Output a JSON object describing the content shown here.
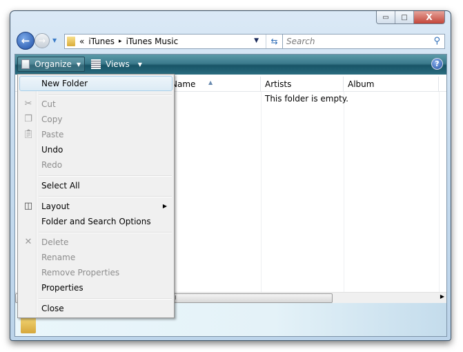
{
  "window": {
    "minimize": "▭",
    "maximize": "□",
    "close": "X"
  },
  "address": {
    "overflow": "«",
    "segments": [
      "iTunes",
      "iTunes Music"
    ],
    "separator": "▸"
  },
  "search": {
    "placeholder": "Search"
  },
  "toolbar": {
    "organize": "Organize",
    "views": "Views",
    "help": "?"
  },
  "columns": [
    "Name",
    "Artists",
    "Album"
  ],
  "empty_message": "This folder is empty.",
  "scrollbar": {
    "grip": "III"
  },
  "menu": {
    "items": [
      {
        "label": "New Folder",
        "enabled": true
      },
      {
        "label": "Cut",
        "enabled": false
      },
      {
        "label": "Copy",
        "enabled": false
      },
      {
        "label": "Paste",
        "enabled": false
      },
      {
        "label": "Undo",
        "enabled": true
      },
      {
        "label": "Redo",
        "enabled": false
      },
      {
        "label": "Select All",
        "enabled": true
      },
      {
        "label": "Layout",
        "enabled": true
      },
      {
        "label": "Folder and Search Options",
        "enabled": true
      },
      {
        "label": "Delete",
        "enabled": false
      },
      {
        "label": "Rename",
        "enabled": false
      },
      {
        "label": "Remove Properties",
        "enabled": false
      },
      {
        "label": "Properties",
        "enabled": true
      },
      {
        "label": "Close",
        "enabled": true
      }
    ]
  }
}
